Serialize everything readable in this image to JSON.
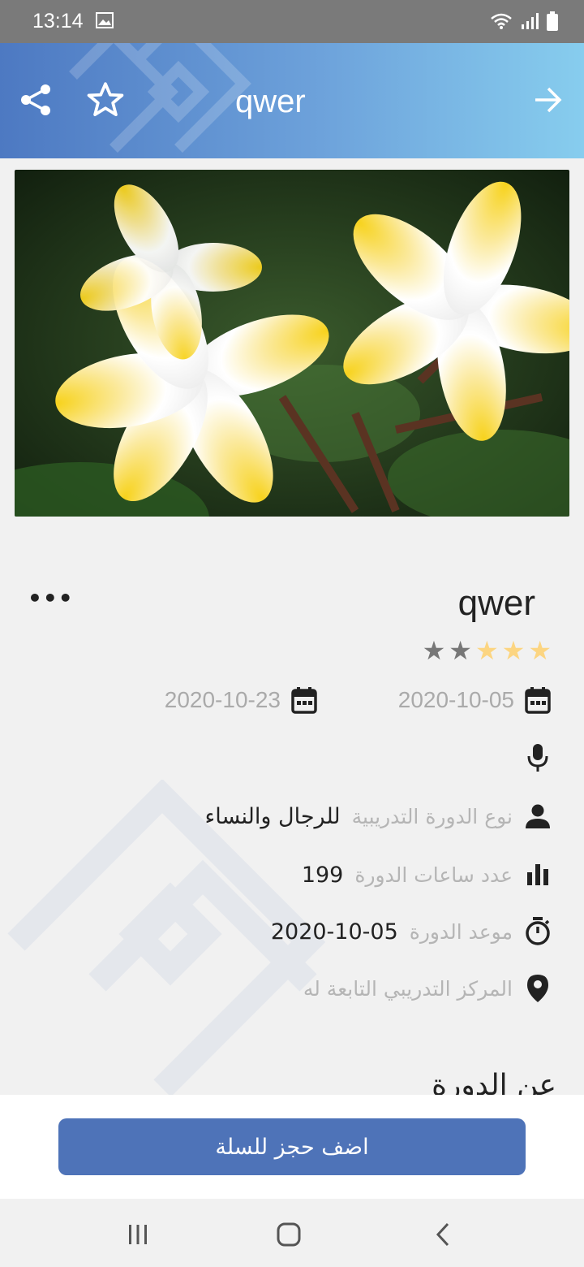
{
  "status_bar": {
    "time": "13:14"
  },
  "app_bar": {
    "title": "qwer",
    "colors": {
      "start": "#4d79c2",
      "end": "#87cdee"
    }
  },
  "hero": {
    "alt": ""
  },
  "course": {
    "title": "qwer",
    "more": "•••",
    "rating": {
      "value": 3,
      "max": 5,
      "filled_color": "#fcd581",
      "empty_color": "#777777"
    },
    "start_date": "2020-10-05",
    "end_date": "2020-10-23",
    "details": {
      "type_label": "نوع الدورة التدريبية",
      "type_value": "للرجال والنساء",
      "hours_label": "عدد ساعات الدورة",
      "hours_value": "199",
      "time_label": "موعد الدورة",
      "time_value": "2020-10-05",
      "center_label": "المركز التدريبي التابعة له"
    },
    "about_heading": "عن الدورة"
  },
  "actions": {
    "add_to_cart": "اضف حجز للسلة",
    "button_color": "#4e73b8"
  }
}
